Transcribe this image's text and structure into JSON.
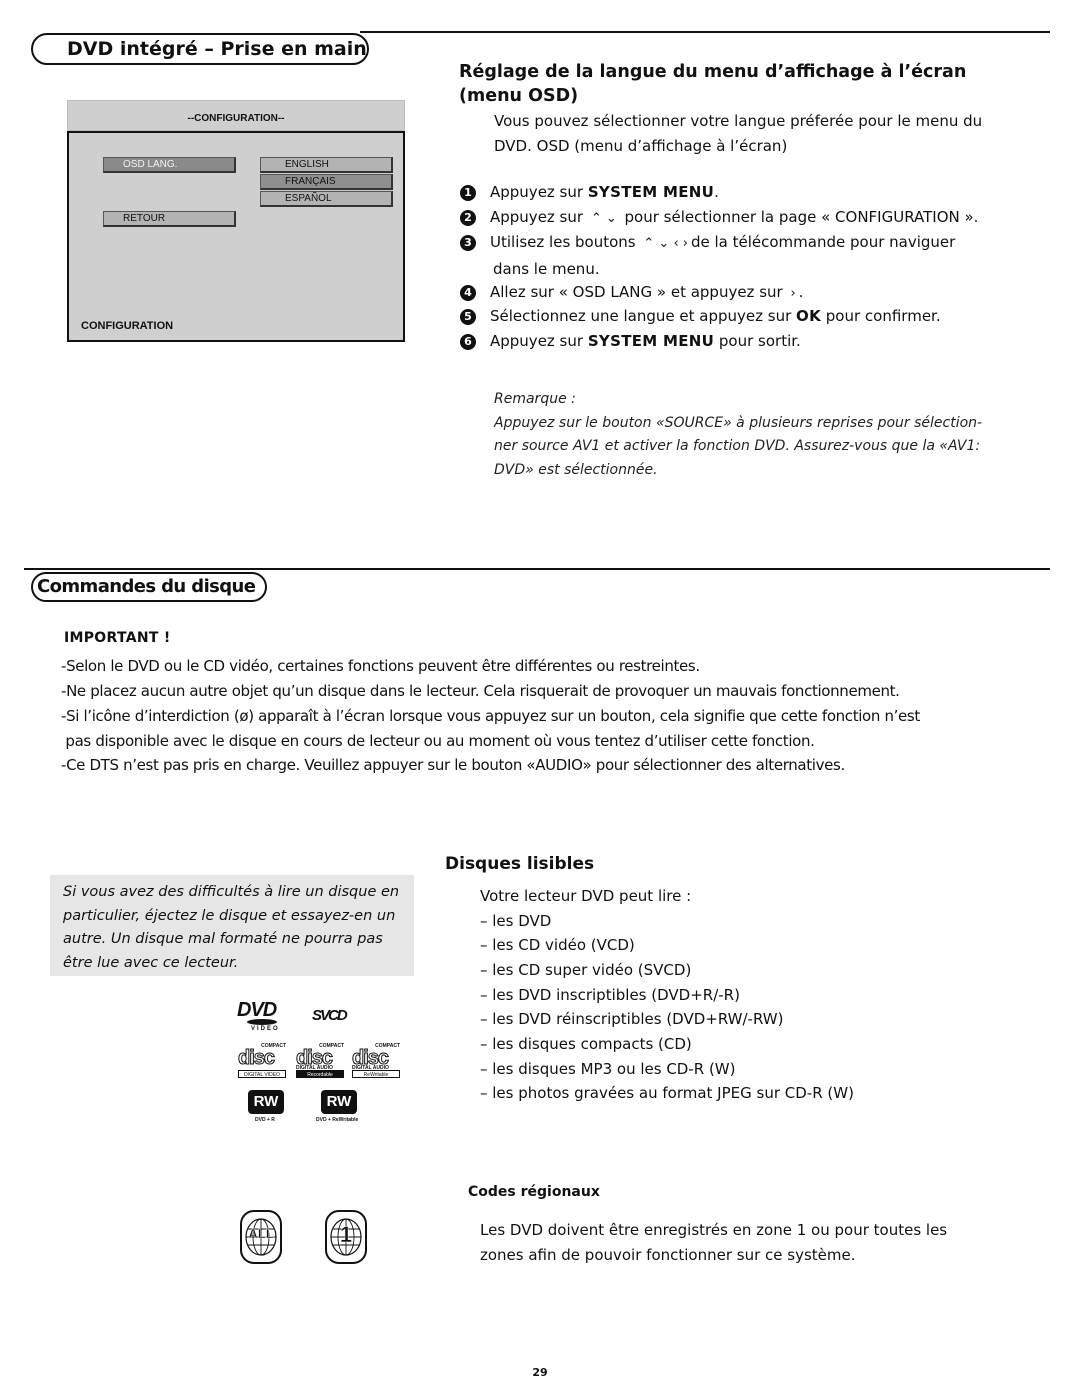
{
  "section1": {
    "title": "DVD intégré – Prise en main",
    "osd_screen": {
      "header": "--CONFIGURATION--",
      "left_buttons": [
        "OSD LANG.",
        "RETOUR"
      ],
      "languages": [
        "ENGLISH",
        "FRANÇAIS",
        "ESPAÑOL"
      ],
      "highlighted_language": "FRANÇAIS",
      "footer": "CONFIGURATION"
    },
    "subsection": {
      "title_line1": "Réglage de la langue du menu d’affichage à l’écran",
      "title_line2_pre": "(menu ",
      "title_line2_bold": "OSD",
      "title_line2_post": ")",
      "intro_line1": "Vous pouvez sélectionner votre langue préferée pour le menu du",
      "intro_line2": "DVD. OSD (menu d’affichage à l’écran)",
      "steps": [
        {
          "num": "1",
          "pre": "Appuyez sur ",
          "bold": "SYSTEM MENU",
          "post": "."
        },
        {
          "num": "2",
          "pre": "Appuyez sur ",
          "arrows": "⌃ ⌄",
          "post": " pour sélectionner la page « CONFIGURATION »."
        },
        {
          "num": "3",
          "pre": "Utilisez les boutons ",
          "arrows": "⌃ ⌄ ‹ ›",
          "post": "de la télécommande pour naviguer",
          "line2": "dans le menu."
        },
        {
          "num": "4",
          "pre": "Allez sur « OSD LANG » et appuyez sur ",
          "arrows": "›",
          "post": "."
        },
        {
          "num": "5",
          "pre": "Sélectionnez une langue et appuyez sur ",
          "bold": "OK",
          "post": " pour confirmer."
        },
        {
          "num": "6",
          "pre": "Appuyez sur ",
          "bold": "SYSTEM MENU",
          "post": " pour sortir."
        }
      ],
      "note_title": "Remarque :",
      "note_lines": [
        "Appuyez sur le bouton «SOURCE» à plusieurs reprises pour sélection-",
        "ner source AV1 et activer la fonction DVD. Assurez-vous que la «AV1:",
        "DVD» est sélectionnée."
      ]
    }
  },
  "section2": {
    "title": "Commandes du disque",
    "important_title": "IMPORTANT !",
    "important_lines": [
      "-Selon le DVD ou le CD vidéo, certaines fonctions peuvent être différentes ou restreintes.",
      "-Ne placez aucun autre objet qu’un disque dans le lecteur. Cela risquerait de provoquer un mauvais fonctionnement.",
      "-Si l’icône d’interdiction (ø) apparaît à l’écran lorsque vous appuyez sur un bouton, cela signifie que cette fonction n’est",
      " pas disponible avec le disque en cours de lecteur ou au moment où vous tentez d’utiliser cette fonction.",
      "-Ce DTS n’est pas pris en charge. Veuillez appuyer sur le bouton «AUDIO» pour sélectionner des alternatives."
    ],
    "tip_lines": [
      "Si vous avez des difficultés à lire un disque en",
      "particulier, éjectez le disque et essayez-en un",
      "autre. Un disque mal formaté ne pourra pas",
      "être lue avec ce lecteur."
    ],
    "logos": {
      "dvd": "DVD",
      "dvd_sub": "VIDEO",
      "svcd": "SVCD",
      "disc_compact": "COMPACT",
      "disc_word": "disc",
      "disc_digital_audio": "DIGITAL AUDIO",
      "disc_captions": [
        "DIGITAL VIDEO",
        "Recordable",
        "ReWritable"
      ],
      "rw": "RW",
      "rw_captions": [
        "DVD + R",
        "DVD + ReWritable"
      ]
    },
    "playable": {
      "title": "Disques lisibles",
      "intro": "Votre lecteur DVD peut lire :",
      "items": [
        "– les DVD",
        "– les CD vidéo (VCD)",
        "– les CD super vidéo (SVCD)",
        "– les DVD inscriptibles (DVD+R/-R)",
        "– les DVD réinscriptibles (DVD+RW/-RW)",
        "– les disques compacts (CD)",
        "– les disques MP3 ou les CD-R (W)",
        "– les photos gravées au format JPEG sur CD-R (W)"
      ]
    },
    "region": {
      "title": "Codes régionaux",
      "badges": [
        "ALL",
        "1"
      ],
      "text_line1": "Les DVD doivent être enregistrés en zone 1 ou pour toutes les",
      "text_line2": "zones afin de pouvoir fonctionner sur ce système."
    }
  },
  "page_number": "29"
}
